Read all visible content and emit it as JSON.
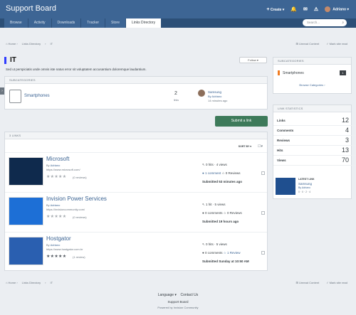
{
  "header": {
    "brand": "Support Board",
    "create_label": "Create",
    "user_name": "Adriano",
    "search_placeholder": "Search..."
  },
  "nav": {
    "tabs": [
      "Browse",
      "Activity",
      "Downloads",
      "Tracker",
      "Store",
      "Links Directory"
    ],
    "active_tab": "Links Directory"
  },
  "breadcrumb": {
    "items": [
      "Home",
      "Links Directory",
      "IT"
    ],
    "unread_label": "Unread Content",
    "mark_read_label": "Mark site read"
  },
  "page": {
    "title": "IT",
    "follow_label": "Follow",
    "description": "Sed ut perspiciatis unde omnis iste natus error sit voluptatem accusantium doloremque laudantium."
  },
  "subcategories": {
    "header": "SUBCATEGORIES",
    "items": [
      {
        "name": "Smartphones",
        "count": "2",
        "count_label": "links",
        "latest_title": "Samsung",
        "latest_by": "By Adriano",
        "latest_time": "14 minutes ago"
      }
    ]
  },
  "submit_button": "Submit a link",
  "links": {
    "header": "3 LINKS",
    "sort_label": "SORT BY",
    "items": [
      {
        "title": "Microsoft",
        "author": "Adriano",
        "url": "https://www.microsoft.com/",
        "rating_stars": 0,
        "reviews": "(0 reviews)",
        "hits": "0 hits",
        "views": "4 views",
        "comments": "1 comment",
        "reviews_count": "0 Reviews",
        "submitted": "Submitted 53 minutes ago"
      },
      {
        "title": "Invision Power Services",
        "author": "Adriano",
        "url": "https://invisioncommunity.com/",
        "rating_stars": 0,
        "reviews": "(0 reviews)",
        "hits": "1 hit",
        "views": "5 views",
        "comments": "0 comments",
        "reviews_count": "0 Reviews",
        "submitted": "Submitted 19 hours ago"
      },
      {
        "title": "Hostgator",
        "author": "Adriano",
        "url": "https://www.hostgator.com.br",
        "rating_stars": 5,
        "reviews": "(1 review)",
        "hits": "0 hits",
        "views": "5 views",
        "comments": "0 comments",
        "reviews_count": "1 Review",
        "submitted": "Submitted Sunday at 10:50 AM"
      }
    ]
  },
  "sidebar": {
    "subcategories_header": "SUBCATEGORIES",
    "subcategory_item": "Smartphones",
    "subcategory_count": "1",
    "browse_label": "Browse Categories",
    "stats_header": "LINK STATISTICS",
    "stats": [
      {
        "label": "Links",
        "value": "12"
      },
      {
        "label": "Comments",
        "value": "4"
      },
      {
        "label": "Reviews",
        "value": "3"
      },
      {
        "label": "Hits",
        "value": "13"
      },
      {
        "label": "Views",
        "value": "70"
      }
    ],
    "latest_label": "LATEST LINK",
    "latest_title": "Samsung",
    "latest_by": "By Adriano",
    "latest_meta": "0 · 0 · 2 · 4"
  },
  "footer": {
    "language_label": "Language",
    "contact_label": "Contact Us",
    "site_name": "Support Board",
    "powered_by": "Powered by Invision Community"
  },
  "colors": {
    "primary": "#3d6594",
    "nav": "#2c4f77",
    "accent": "#3d7a5a",
    "marker": "#2f3cff",
    "orange": "#f07c22"
  }
}
